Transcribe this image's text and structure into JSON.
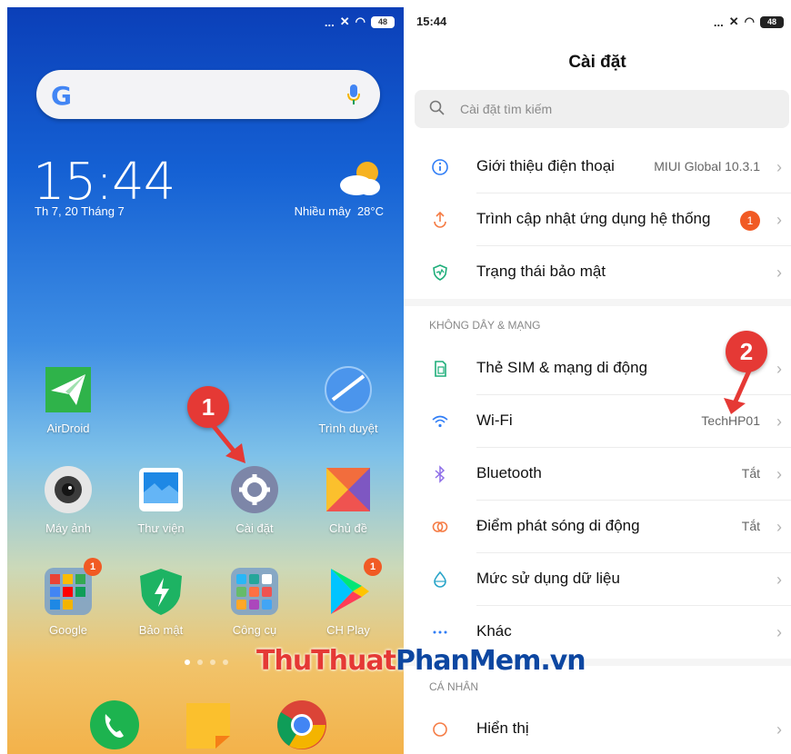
{
  "home": {
    "status": {
      "icons": "...",
      "battery": "48"
    },
    "clock": "15:44",
    "date": "Th 7, 20 Tháng 7",
    "weather": {
      "text": "Nhiều mây",
      "temp": "28°C"
    },
    "apps": [
      {
        "label": "AirDroid"
      },
      {
        "label": "Trình duyệt"
      },
      {
        "label": "Máy ảnh"
      },
      {
        "label": "Thư viện"
      },
      {
        "label": "Cài đặt"
      },
      {
        "label": "Chủ đề"
      },
      {
        "label": "Google",
        "badge": "1"
      },
      {
        "label": "Bảo mật"
      },
      {
        "label": "Công cụ"
      },
      {
        "label": "CH Play",
        "badge": "1"
      }
    ],
    "marker": "1"
  },
  "settings": {
    "status": {
      "time": "15:44",
      "icons": "...",
      "battery": "48"
    },
    "title": "Cài đặt",
    "search_placeholder": "Cài đặt tìm kiếm",
    "items_top": [
      {
        "label": "Giới thiệu điện thoại",
        "value": "MIUI Global 10.3.1"
      },
      {
        "label": "Trình cập nhật ứng dụng hệ thống",
        "badge": "1"
      },
      {
        "label": "Trạng thái bảo mật"
      }
    ],
    "section_wireless": "KHÔNG DÂY & MẠNG",
    "items_wireless": [
      {
        "label": "Thẻ SIM & mạng di động"
      },
      {
        "label": "Wi-Fi",
        "value": "TechHP01"
      },
      {
        "label": "Bluetooth",
        "value": "Tắt"
      },
      {
        "label": "Điểm phát sóng di động",
        "value": "Tắt"
      },
      {
        "label": "Mức sử dụng dữ liệu"
      },
      {
        "label": "Khác"
      }
    ],
    "section_personal": "CÁ NHÂN",
    "items_personal": [
      {
        "label": "Hiển thị"
      }
    ],
    "marker": "2"
  },
  "watermark": {
    "part1": "ThuThuat",
    "part2": "PhanMem",
    "part3": ".vn"
  },
  "colors": {
    "accent_orange": "#f15a24",
    "marker_red": "#e53935",
    "icon_blue": "#2f7df6"
  }
}
